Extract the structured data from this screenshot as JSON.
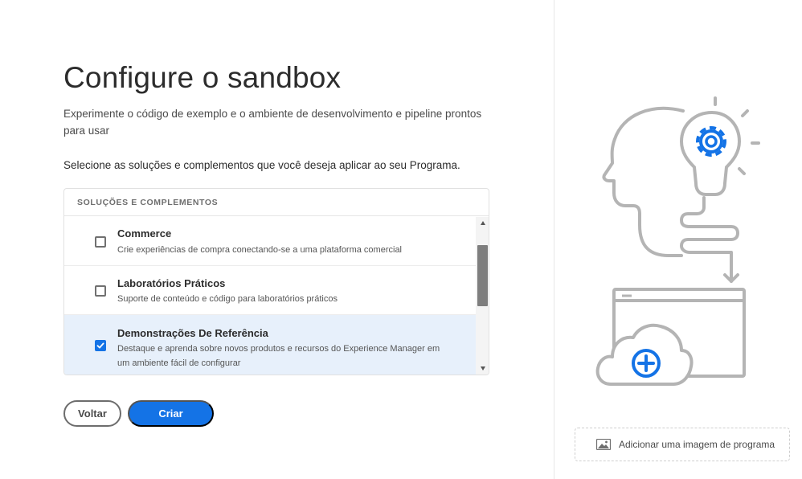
{
  "page": {
    "title": "Configure o sandbox",
    "description": "Experimente o código de exemplo e o ambiente de desenvolvimento e pipeline prontos para usar",
    "instruction": "Selecione as soluções e complementos que você deseja aplicar ao seu Programa."
  },
  "solutions": {
    "header": "SOLUÇÕES E COMPLEMENTOS",
    "items": [
      {
        "title": "Commerce",
        "description": "Crie experiências de compra conectando-se a uma plataforma comercial",
        "checked": false
      },
      {
        "title": "Laboratórios Práticos",
        "description": "Suporte de conteúdo e código para laboratórios práticos",
        "checked": false
      },
      {
        "title": "Demonstrações De Referência",
        "description": "Destaque e aprenda sobre novos produtos e recursos do Experience Manager em um ambiente fácil de configurar",
        "checked": true
      }
    ]
  },
  "actions": {
    "back_label": "Voltar",
    "create_label": "Criar"
  },
  "sidebar": {
    "add_image_label": "Adicionar uma imagem de programa"
  },
  "colors": {
    "accent": "#1473e6",
    "selected_row": "#e7f0fb",
    "illustration_stroke": "#b4b4b4"
  }
}
